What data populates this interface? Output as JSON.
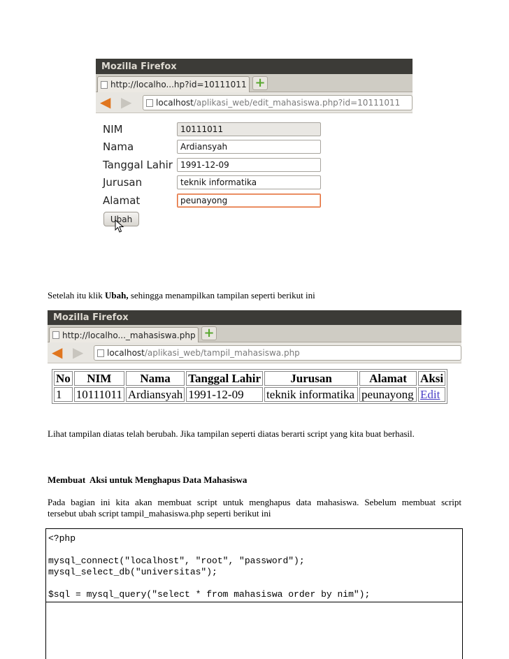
{
  "shot1": {
    "window_title": "Mozilla Firefox",
    "tab_label": "http://localho...hp?id=10111011",
    "url_host": "localhost",
    "url_path": "/aplikasi_web/edit_mahasiswa.php?id=10111011",
    "fields": [
      {
        "label": "NIM",
        "value": "10111011"
      },
      {
        "label": "Nama",
        "value": "Ardiansyah"
      },
      {
        "label": "Tanggal Lahir",
        "value": "1991-12-09"
      },
      {
        "label": "Jurusan",
        "value": "teknik informatika"
      },
      {
        "label": "Alamat",
        "value": "peunayong"
      }
    ],
    "submit_label": "Ubah"
  },
  "caption1": {
    "before": "Setelah itu klik ",
    "bold": "Ubah,",
    "after": " sehingga menampilkan tampilan seperti berikut ini"
  },
  "shot2": {
    "window_title": "Mozilla Firefox",
    "tab_label": "http://localho..._mahasiswa.php",
    "url_host": "localhost",
    "url_path": "/aplikasi_web/tampil_mahasiswa.php",
    "table": {
      "headers": [
        "No",
        "NIM",
        "Nama",
        "Tanggal Lahir",
        "Jurusan",
        "Alamat",
        "Aksi"
      ],
      "row": [
        "1",
        "10111011",
        "Ardiansyah",
        "1991-12-09",
        "teknik informatika",
        "peunayong",
        "Edit"
      ]
    }
  },
  "caption2": "Lihat tampilan diatas telah berubah. Jika tampilan seperti diatas berarti script yang kita buat berhasil.",
  "section_heading": "Membuat  Aksi untuk Menghapus Data Mahasiswa",
  "paragraph": {
    "line1": "Pada bagian ini kita akan membuat script untuk menghapus data mahasiswa. Sebelum membuat script",
    "line2": "tersebut ubah script tampil_mahasiswa.php seperti berikut ini"
  },
  "code": [
    "<?php",
    "",
    "mysql_connect(\"localhost\", \"root\", \"password\");",
    "mysql_select_db(\"universitas\");",
    "",
    "$sql = mysql_query(\"select * from mahasiswa order by nim\");"
  ],
  "colors": {
    "title_bar": "#3c3b37",
    "back_arrow": "#e0761f",
    "new_tab_plus": "#5aa830",
    "link": "#4a3fc7",
    "focus_border": "#e36b36"
  }
}
